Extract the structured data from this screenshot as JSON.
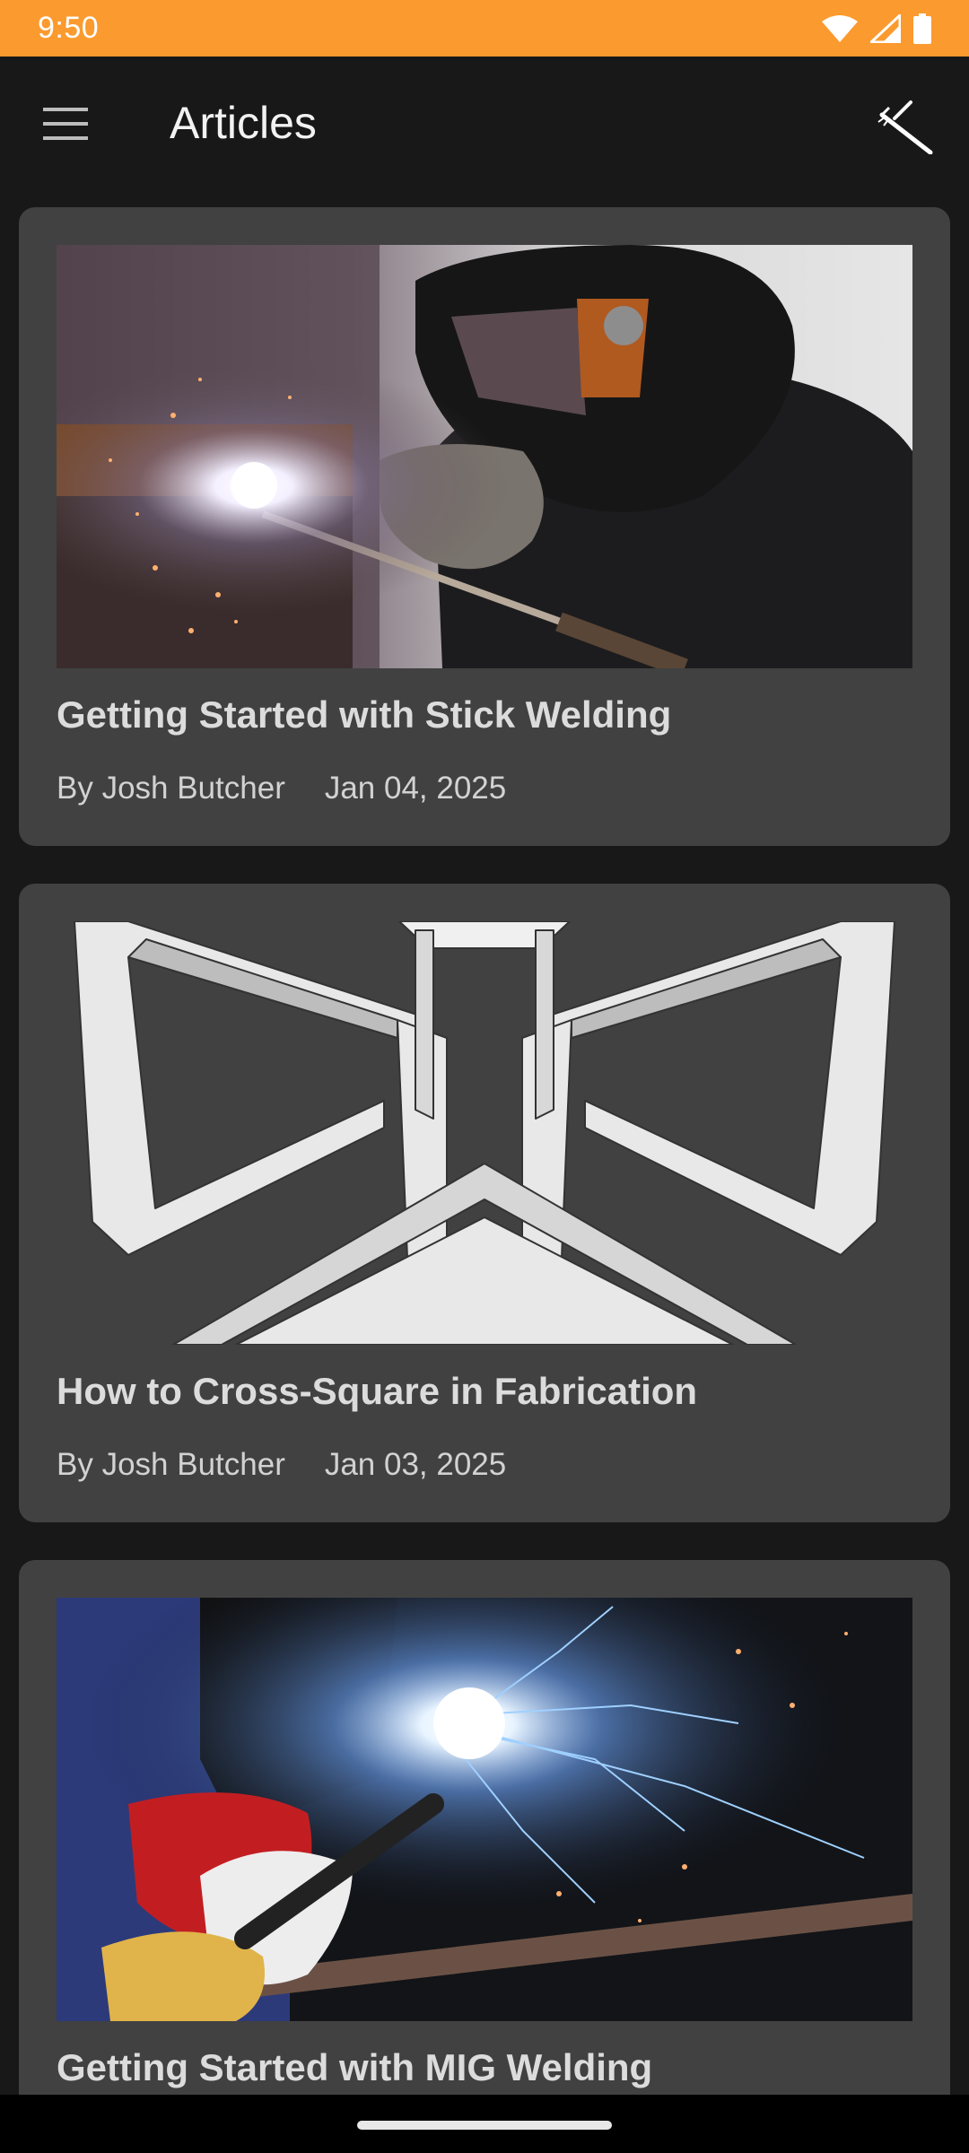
{
  "status_bar": {
    "time": "9:50",
    "icons": [
      "wifi-icon",
      "cellular-signal-icon",
      "battery-icon"
    ],
    "background": "#FB9A2E"
  },
  "app_bar": {
    "title": "Articles",
    "left_icon": "hamburger-menu-icon",
    "right_icon": "welding-torch-icon"
  },
  "articles": [
    {
      "title": "Getting Started with Stick Welding",
      "author": "By Josh Butcher",
      "date": "Jan 04, 2025",
      "image": "welder-with-helmet-stick-welding-photo"
    },
    {
      "title": "How to Cross-Square in Fabrication",
      "author": "By Josh Butcher",
      "date": "Jan 03, 2025",
      "image": "square-tube-frame-diagram"
    },
    {
      "title": "Getting Started with MIG Welding",
      "author": "",
      "date": "",
      "image": "mig-welding-sparks-photo"
    }
  ],
  "colors": {
    "accent": "#FB9A2E",
    "background": "#181818",
    "card": "#414141"
  }
}
